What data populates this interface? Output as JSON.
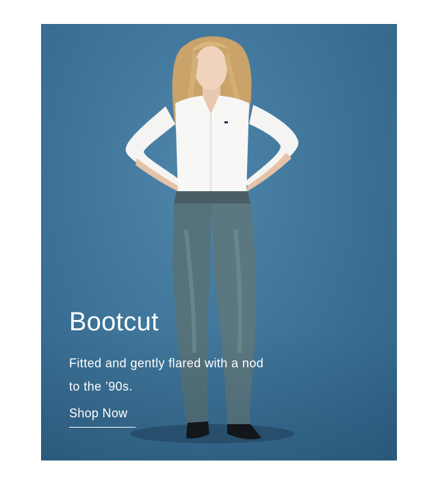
{
  "hero": {
    "title": "Bootcut",
    "description": "Fitted and gently flared with a nod to the ’90s.",
    "cta_label": "Shop Now",
    "background_color": "#3f7599",
    "text_color": "#ffffff"
  }
}
